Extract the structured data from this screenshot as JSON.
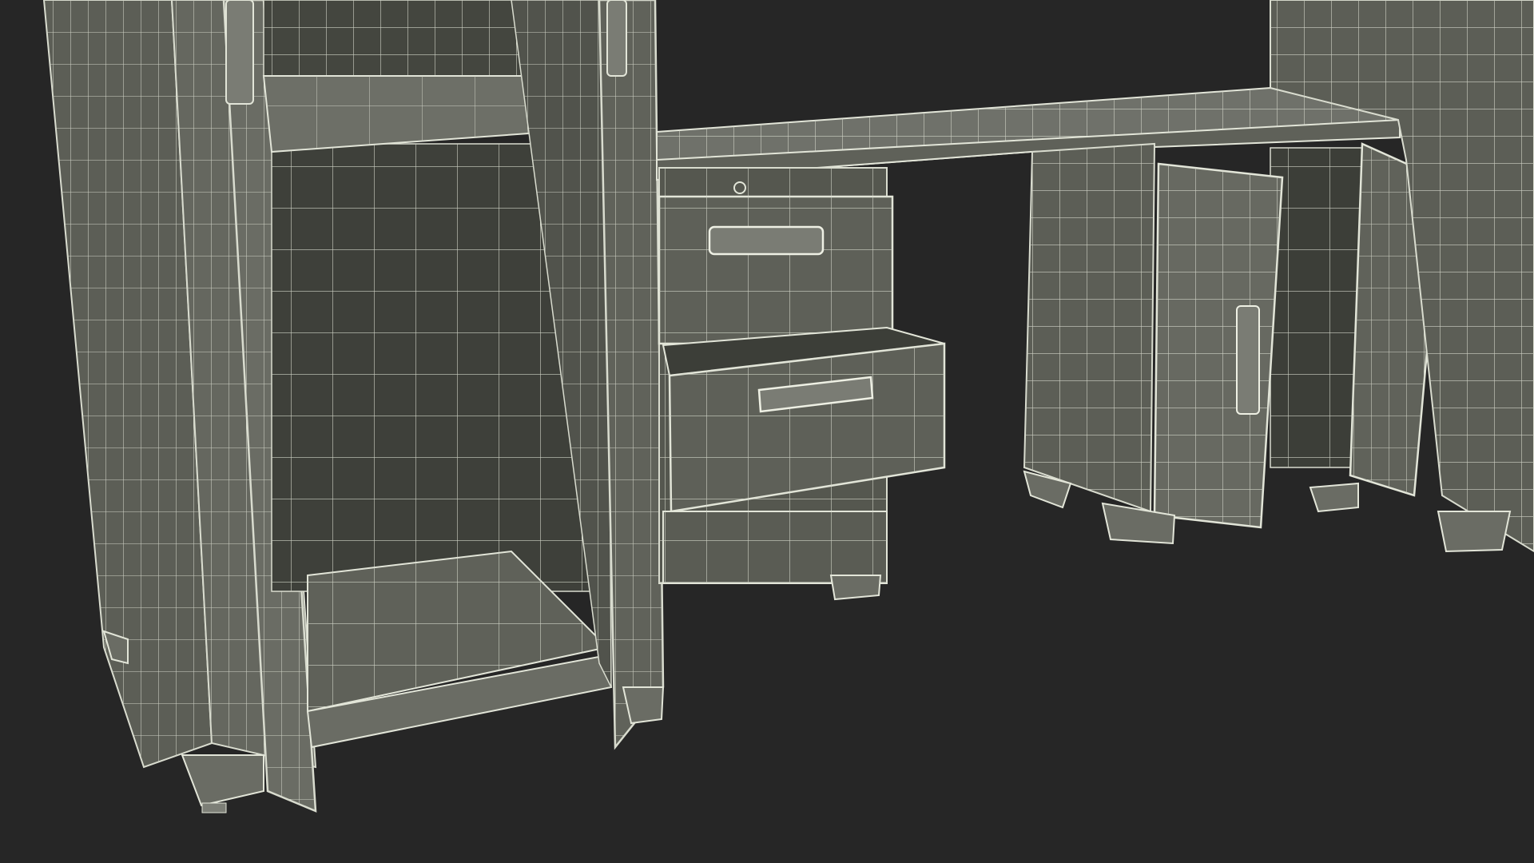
{
  "scene": {
    "subject": "3d-wireframe-render-of-cabinets-workbench",
    "colors": {
      "background": "#262626",
      "face": "#5b5d55",
      "face_light": "#6f726a",
      "face_dark": "#45473f",
      "interior": "#3b3d37",
      "edge": "#d9dccf",
      "wire": "#c7cabd"
    }
  }
}
